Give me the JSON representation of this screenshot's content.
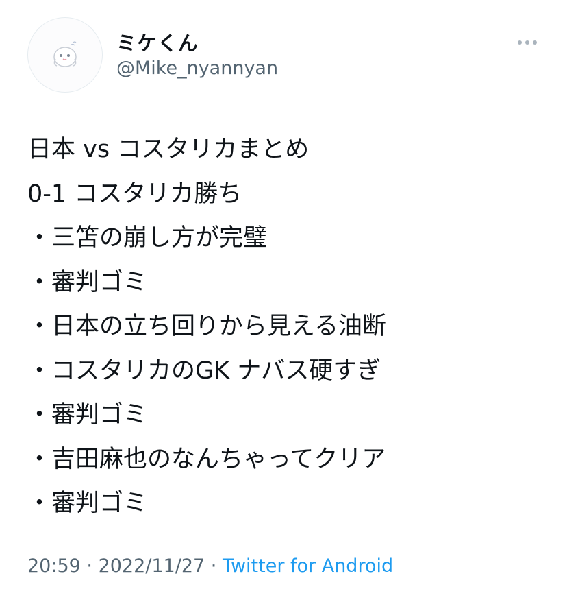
{
  "author": {
    "display_name": "ミケくん",
    "handle": "@Mike_nyannyan",
    "avatar_icon": "ghost-cat-avatar"
  },
  "tweet": {
    "lines": [
      "日本 vs コスタリカまとめ",
      "0-1 コスタリカ勝ち",
      "・三笘の崩し方が完璧",
      "・審判ゴミ",
      "・日本の立ち回りから見える油断",
      "・コスタリカのGK ナバス硬すぎ",
      "・審判ゴミ",
      "・吉田麻也のなんちゃってクリア",
      "・審判ゴミ"
    ]
  },
  "meta": {
    "time": "20:59",
    "separator1": " · ",
    "date": "2022/11/27",
    "separator2": " · ",
    "source": "Twitter for Android"
  },
  "icons": {
    "more": "more-icon"
  },
  "colors": {
    "text": "#0f1419",
    "secondary": "#536471",
    "link": "#1d9bf0",
    "border": "#e6ecf0"
  }
}
